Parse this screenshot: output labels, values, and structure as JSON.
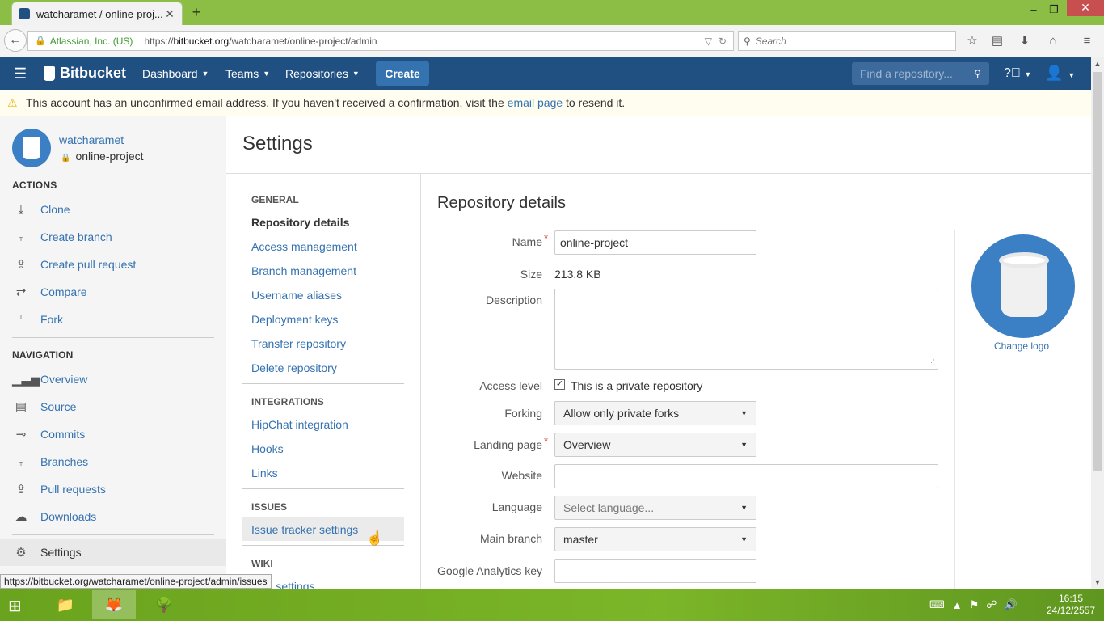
{
  "browser": {
    "tab_title": "watcharamet / online-proj...",
    "identity": "Atlassian, Inc. (US)",
    "url_prefix": "https://",
    "url_domain": "bitbucket.org",
    "url_path": "/watcharamet/online-project/admin",
    "search_placeholder": "Search"
  },
  "header": {
    "logo": "Bitbucket",
    "nav": [
      "Dashboard",
      "Teams",
      "Repositories"
    ],
    "create": "Create",
    "search_placeholder": "Find a repository..."
  },
  "banner": {
    "text_before": "This account has an unconfirmed email address. If you haven't received a confirmation, visit the ",
    "link": "email page",
    "text_after": " to resend it."
  },
  "sidebar": {
    "owner": "watcharamet",
    "repo": "online-project",
    "actions_heading": "ACTIONS",
    "actions": [
      {
        "label": "Clone",
        "icon": "download-icon"
      },
      {
        "label": "Create branch",
        "icon": "branch-icon"
      },
      {
        "label": "Create pull request",
        "icon": "pull-request-icon"
      },
      {
        "label": "Compare",
        "icon": "compare-icon"
      },
      {
        "label": "Fork",
        "icon": "fork-icon"
      }
    ],
    "navigation_heading": "NAVIGATION",
    "navigation": [
      {
        "label": "Overview",
        "icon": "chart-icon"
      },
      {
        "label": "Source",
        "icon": "file-icon"
      },
      {
        "label": "Commits",
        "icon": "commit-icon"
      },
      {
        "label": "Branches",
        "icon": "branch-icon"
      },
      {
        "label": "Pull requests",
        "icon": "pull-request-icon"
      },
      {
        "label": "Downloads",
        "icon": "cloud-download-icon"
      }
    ],
    "settings": "Settings"
  },
  "settings": {
    "title": "Settings",
    "general_heading": "GENERAL",
    "general": [
      "Repository details",
      "Access management",
      "Branch management",
      "Username aliases",
      "Deployment keys",
      "Transfer repository",
      "Delete repository"
    ],
    "integrations_heading": "INTEGRATIONS",
    "integrations": [
      "HipChat integration",
      "Hooks",
      "Links"
    ],
    "issues_heading": "ISSUES",
    "issues": [
      "Issue tracker settings"
    ],
    "wiki_heading": "WIKI",
    "wiki": [
      "Wiki settings"
    ]
  },
  "form": {
    "title": "Repository details",
    "name_label": "Name",
    "name_value": "online-project",
    "size_label": "Size",
    "size_value": "213.8 KB",
    "description_label": "Description",
    "description_value": "",
    "access_label": "Access level",
    "access_checked": true,
    "access_text": "This is a private repository",
    "forking_label": "Forking",
    "forking_value": "Allow only private forks",
    "landing_label": "Landing page",
    "landing_value": "Overview",
    "website_label": "Website",
    "website_value": "",
    "language_label": "Language",
    "language_placeholder": "Select language...",
    "branch_label": "Main branch",
    "branch_value": "master",
    "ga_label": "Google Analytics key",
    "ga_value": "",
    "change_logo": "Change logo"
  },
  "status_url": "https://bitbucket.org/watcharamet/online-project/admin/issues",
  "taskbar": {
    "time": "16:15",
    "date": "24/12/2557"
  }
}
